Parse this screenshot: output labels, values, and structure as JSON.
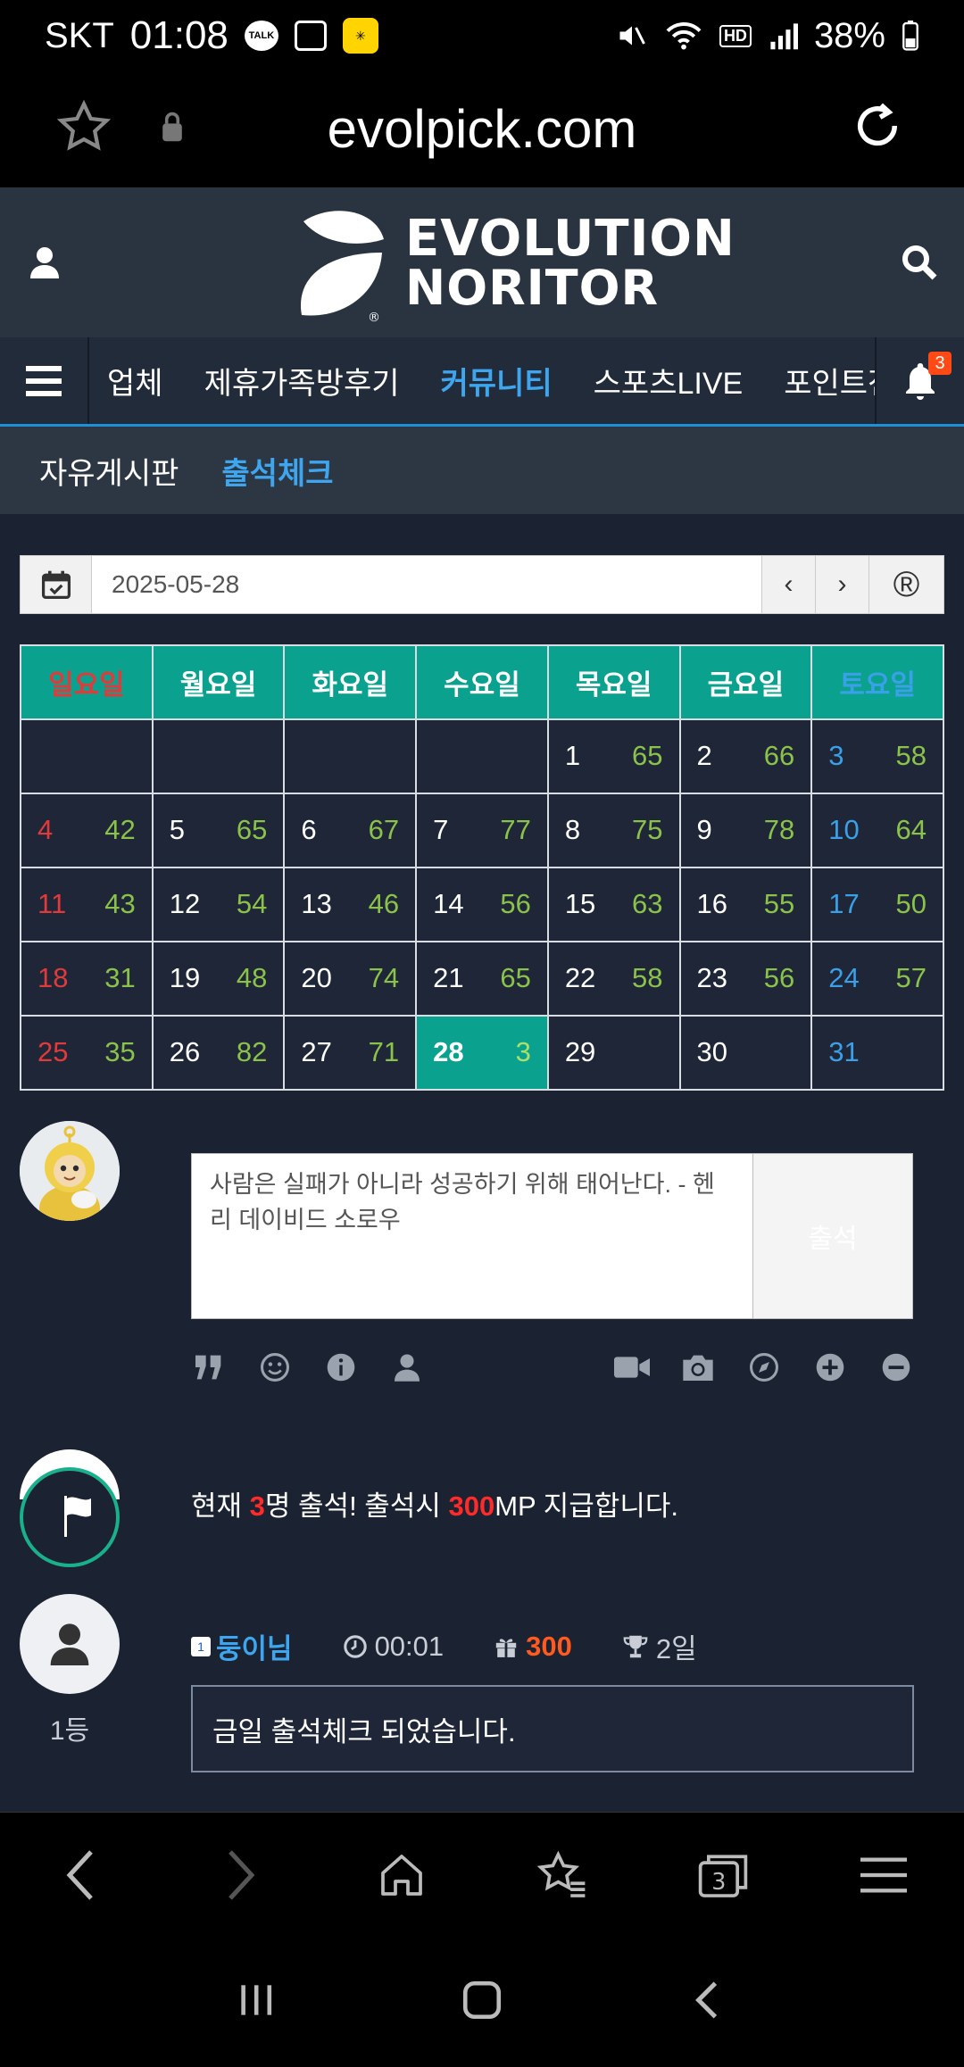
{
  "status_bar": {
    "carrier": "SKT",
    "time": "01:08",
    "notif_talk": "TALK",
    "battery": "38%",
    "hd_voice": "HD"
  },
  "browser": {
    "url": "evolpick.com",
    "tab_count": "3"
  },
  "logo": {
    "line1": "EVOLUTION",
    "line2": "NORITOR",
    "registered": "®"
  },
  "nav": {
    "items": [
      {
        "label": "업체"
      },
      {
        "label": "제휴가족방후기"
      },
      {
        "label": "커뮤니티"
      },
      {
        "label": "스포츠LIVE"
      },
      {
        "label": "포인트전"
      }
    ],
    "bell_badge": "3"
  },
  "subnav": {
    "items": [
      {
        "label": "자유게시판"
      },
      {
        "label": "출석체크"
      }
    ]
  },
  "datebar": {
    "date": "2025-05-28",
    "prev": "‹",
    "next": "›",
    "reset": "®"
  },
  "calendar": {
    "headers": [
      "일요일",
      "월요일",
      "화요일",
      "수요일",
      "목요일",
      "금요일",
      "토요일"
    ],
    "weeks": [
      [
        {
          "d": "",
          "n": ""
        },
        {
          "d": "",
          "n": ""
        },
        {
          "d": "",
          "n": ""
        },
        {
          "d": "",
          "n": ""
        },
        {
          "d": "1",
          "n": "65"
        },
        {
          "d": "2",
          "n": "66"
        },
        {
          "d": "3",
          "n": "58"
        }
      ],
      [
        {
          "d": "4",
          "n": "42"
        },
        {
          "d": "5",
          "n": "65"
        },
        {
          "d": "6",
          "n": "67"
        },
        {
          "d": "7",
          "n": "77"
        },
        {
          "d": "8",
          "n": "75"
        },
        {
          "d": "9",
          "n": "78"
        },
        {
          "d": "10",
          "n": "64"
        }
      ],
      [
        {
          "d": "11",
          "n": "43"
        },
        {
          "d": "12",
          "n": "54"
        },
        {
          "d": "13",
          "n": "46"
        },
        {
          "d": "14",
          "n": "56"
        },
        {
          "d": "15",
          "n": "63"
        },
        {
          "d": "16",
          "n": "55"
        },
        {
          "d": "17",
          "n": "50"
        }
      ],
      [
        {
          "d": "18",
          "n": "31"
        },
        {
          "d": "19",
          "n": "48"
        },
        {
          "d": "20",
          "n": "74"
        },
        {
          "d": "21",
          "n": "65"
        },
        {
          "d": "22",
          "n": "58"
        },
        {
          "d": "23",
          "n": "56"
        },
        {
          "d": "24",
          "n": "57"
        }
      ],
      [
        {
          "d": "25",
          "n": "35"
        },
        {
          "d": "26",
          "n": "82"
        },
        {
          "d": "27",
          "n": "71"
        },
        {
          "d": "28",
          "n": "3"
        },
        {
          "d": "29",
          "n": ""
        },
        {
          "d": "30",
          "n": ""
        },
        {
          "d": "31",
          "n": ""
        }
      ]
    ],
    "today": "28"
  },
  "comment": {
    "text": "사람은 실패가 아니라 성공하기 위해 태어난다. - 헨리 데이비드 소로우",
    "submit_label": "출석"
  },
  "summary": {
    "prefix": "현재 ",
    "count": "3",
    "middle": "명 출석! 출석시 ",
    "points": "300",
    "suffix": "MP 지급합니다."
  },
  "entry": {
    "level": "1",
    "name": "둥이님",
    "time": "00:01",
    "points": "300",
    "streak": "2일",
    "rank": "1등",
    "message": "금일 출석체크 되었습니다."
  },
  "colors": {
    "accent": "#3ea6ef",
    "teal": "#0aa28e",
    "sunday": "#e03a3a",
    "saturday": "#3aa0e8",
    "count_green": "#8ac24a",
    "points_orange": "#ff5a1f"
  }
}
